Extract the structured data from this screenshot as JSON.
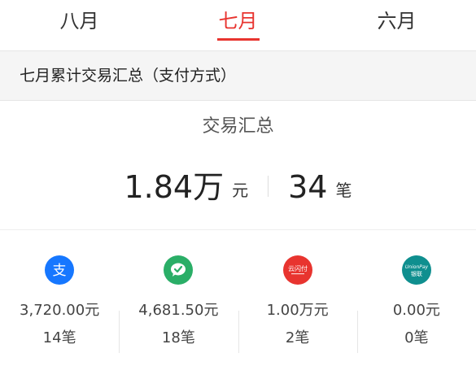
{
  "tabs": [
    {
      "label": "八月",
      "active": false
    },
    {
      "label": "七月",
      "active": true
    },
    {
      "label": "六月",
      "active": false
    }
  ],
  "section_header": "七月累计交易汇总（支付方式）",
  "summary": {
    "title": "交易汇总",
    "amount_value": "1.84万",
    "amount_unit": "元",
    "count_value": "34",
    "count_unit": "笔"
  },
  "payment_methods": [
    {
      "icon": "alipay-icon",
      "color": "#1677ff",
      "glyph": "支",
      "amount": "3,720.00元",
      "count": "14笔"
    },
    {
      "icon": "wechat-pay-icon",
      "color": "#2aae67",
      "glyph": "",
      "amount": "4,681.50元",
      "count": "18笔"
    },
    {
      "icon": "quickpass-icon",
      "color": "#e8342f",
      "glyph": "云闪付",
      "amount": "1.00万元",
      "count": "2笔"
    },
    {
      "icon": "unionpay-icon",
      "color": "#0f8f8f",
      "glyph": "UnionPay 银联",
      "amount": "0.00元",
      "count": "0笔"
    }
  ],
  "colors": {
    "accent": "#e8342f",
    "header_bg": "#f5f5f5"
  }
}
